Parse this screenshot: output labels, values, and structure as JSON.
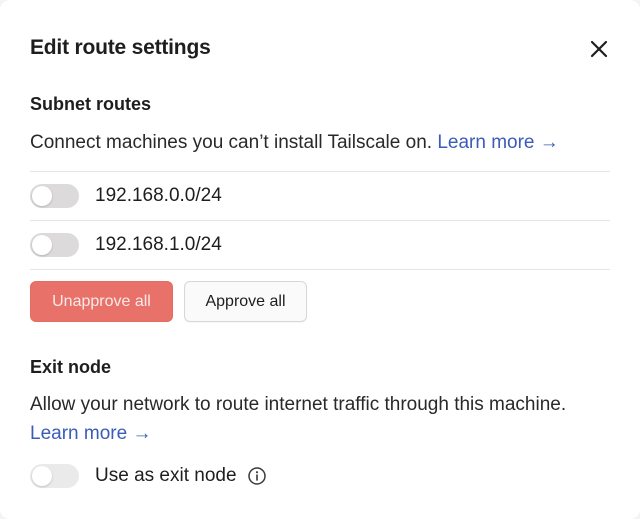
{
  "dialog": {
    "title": "Edit route settings",
    "close_icon": "close-icon"
  },
  "subnet": {
    "heading": "Subnet routes",
    "description": "Connect machines you can’t install Tailscale on.",
    "learn_more": "Learn more →",
    "routes": [
      {
        "cidr": "192.168.0.0/24",
        "enabled": false
      },
      {
        "cidr": "192.168.1.0/24",
        "enabled": false
      }
    ],
    "unapprove_label": "Unapprove all",
    "approve_label": "Approve all"
  },
  "exit_node": {
    "heading": "Exit node",
    "description": "Allow your network to route internet traffic through this machine.",
    "learn_more": "Learn more →",
    "toggle_label": "Use as exit node",
    "enabled": false,
    "info_icon": "info-icon"
  },
  "colors": {
    "danger": "#e8726a",
    "link": "#3b5cb8",
    "toggle_off": "#dcdada"
  }
}
